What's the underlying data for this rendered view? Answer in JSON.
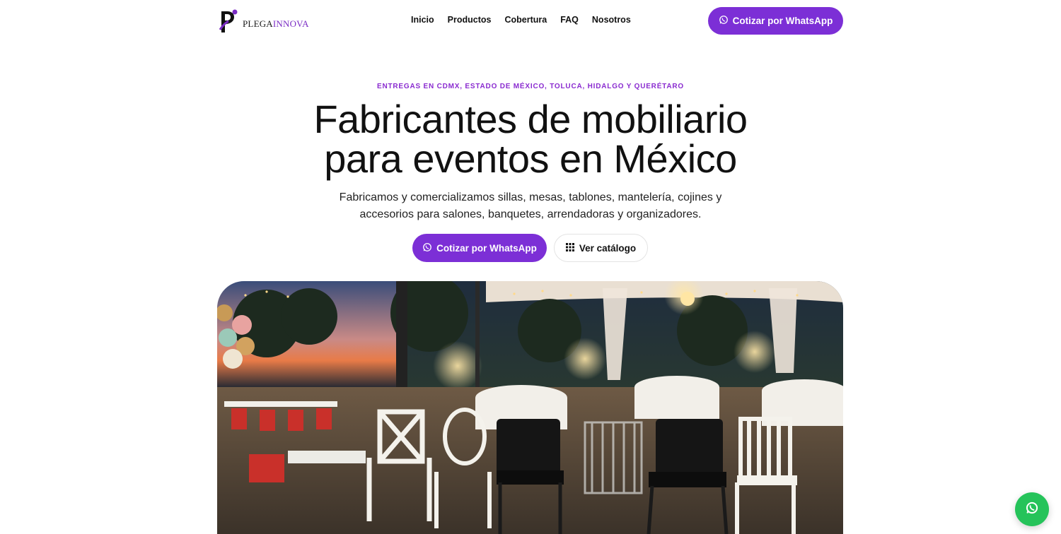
{
  "brand": {
    "name_main": "PLEGA",
    "name_accent": "INNOVA",
    "accent_color": "#7b2cc4"
  },
  "nav": {
    "items": [
      "Inicio",
      "Productos",
      "Cobertura",
      "FAQ",
      "Nosotros"
    ]
  },
  "header_cta": {
    "label": "Cotizar por WhatsApp",
    "icon": "whatsapp-icon"
  },
  "hero": {
    "eyebrow": "ENTREGAS EN CDMX, ESTADO DE MÉXICO, TOLUCA, HIDALGO Y QUERÉTARO",
    "title_line1": "Fabricantes de mobiliario",
    "title_line2": "para eventos en México",
    "subtitle": "Fabricamos y comercializamos sillas, mesas, tablones, mantelería, cojines y accesorios para salones, banquetes, arrendadoras y organizadores.",
    "primary_cta": "Cotizar por WhatsApp",
    "secondary_cta": "Ver catálogo",
    "secondary_icon": "grid-icon"
  },
  "floating_button": {
    "icon": "whatsapp-icon",
    "color": "#25c35a"
  },
  "colors": {
    "primary": "#7c2fd6",
    "eyebrow": "#8a2bd0"
  }
}
